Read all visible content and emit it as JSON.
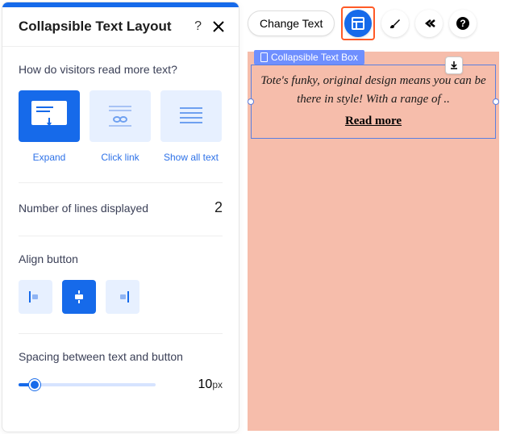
{
  "panel": {
    "title": "Collapsible Text Layout",
    "help": "?",
    "section_read": "How do visitors read more text?",
    "options": [
      "Expand",
      "Click link",
      "Show all text"
    ],
    "lines_label": "Number of lines displayed",
    "lines_value": "2",
    "align_label": "Align button",
    "spacing_label": "Spacing between text and button",
    "spacing_value": "10",
    "spacing_unit": "px"
  },
  "toolbar": {
    "change_text": "Change Text"
  },
  "canvas": {
    "badge": "Collapsible Text Box",
    "text": "Tote's funky, original design means you can be there in style! With a range of ..",
    "read_more": "Read more"
  }
}
